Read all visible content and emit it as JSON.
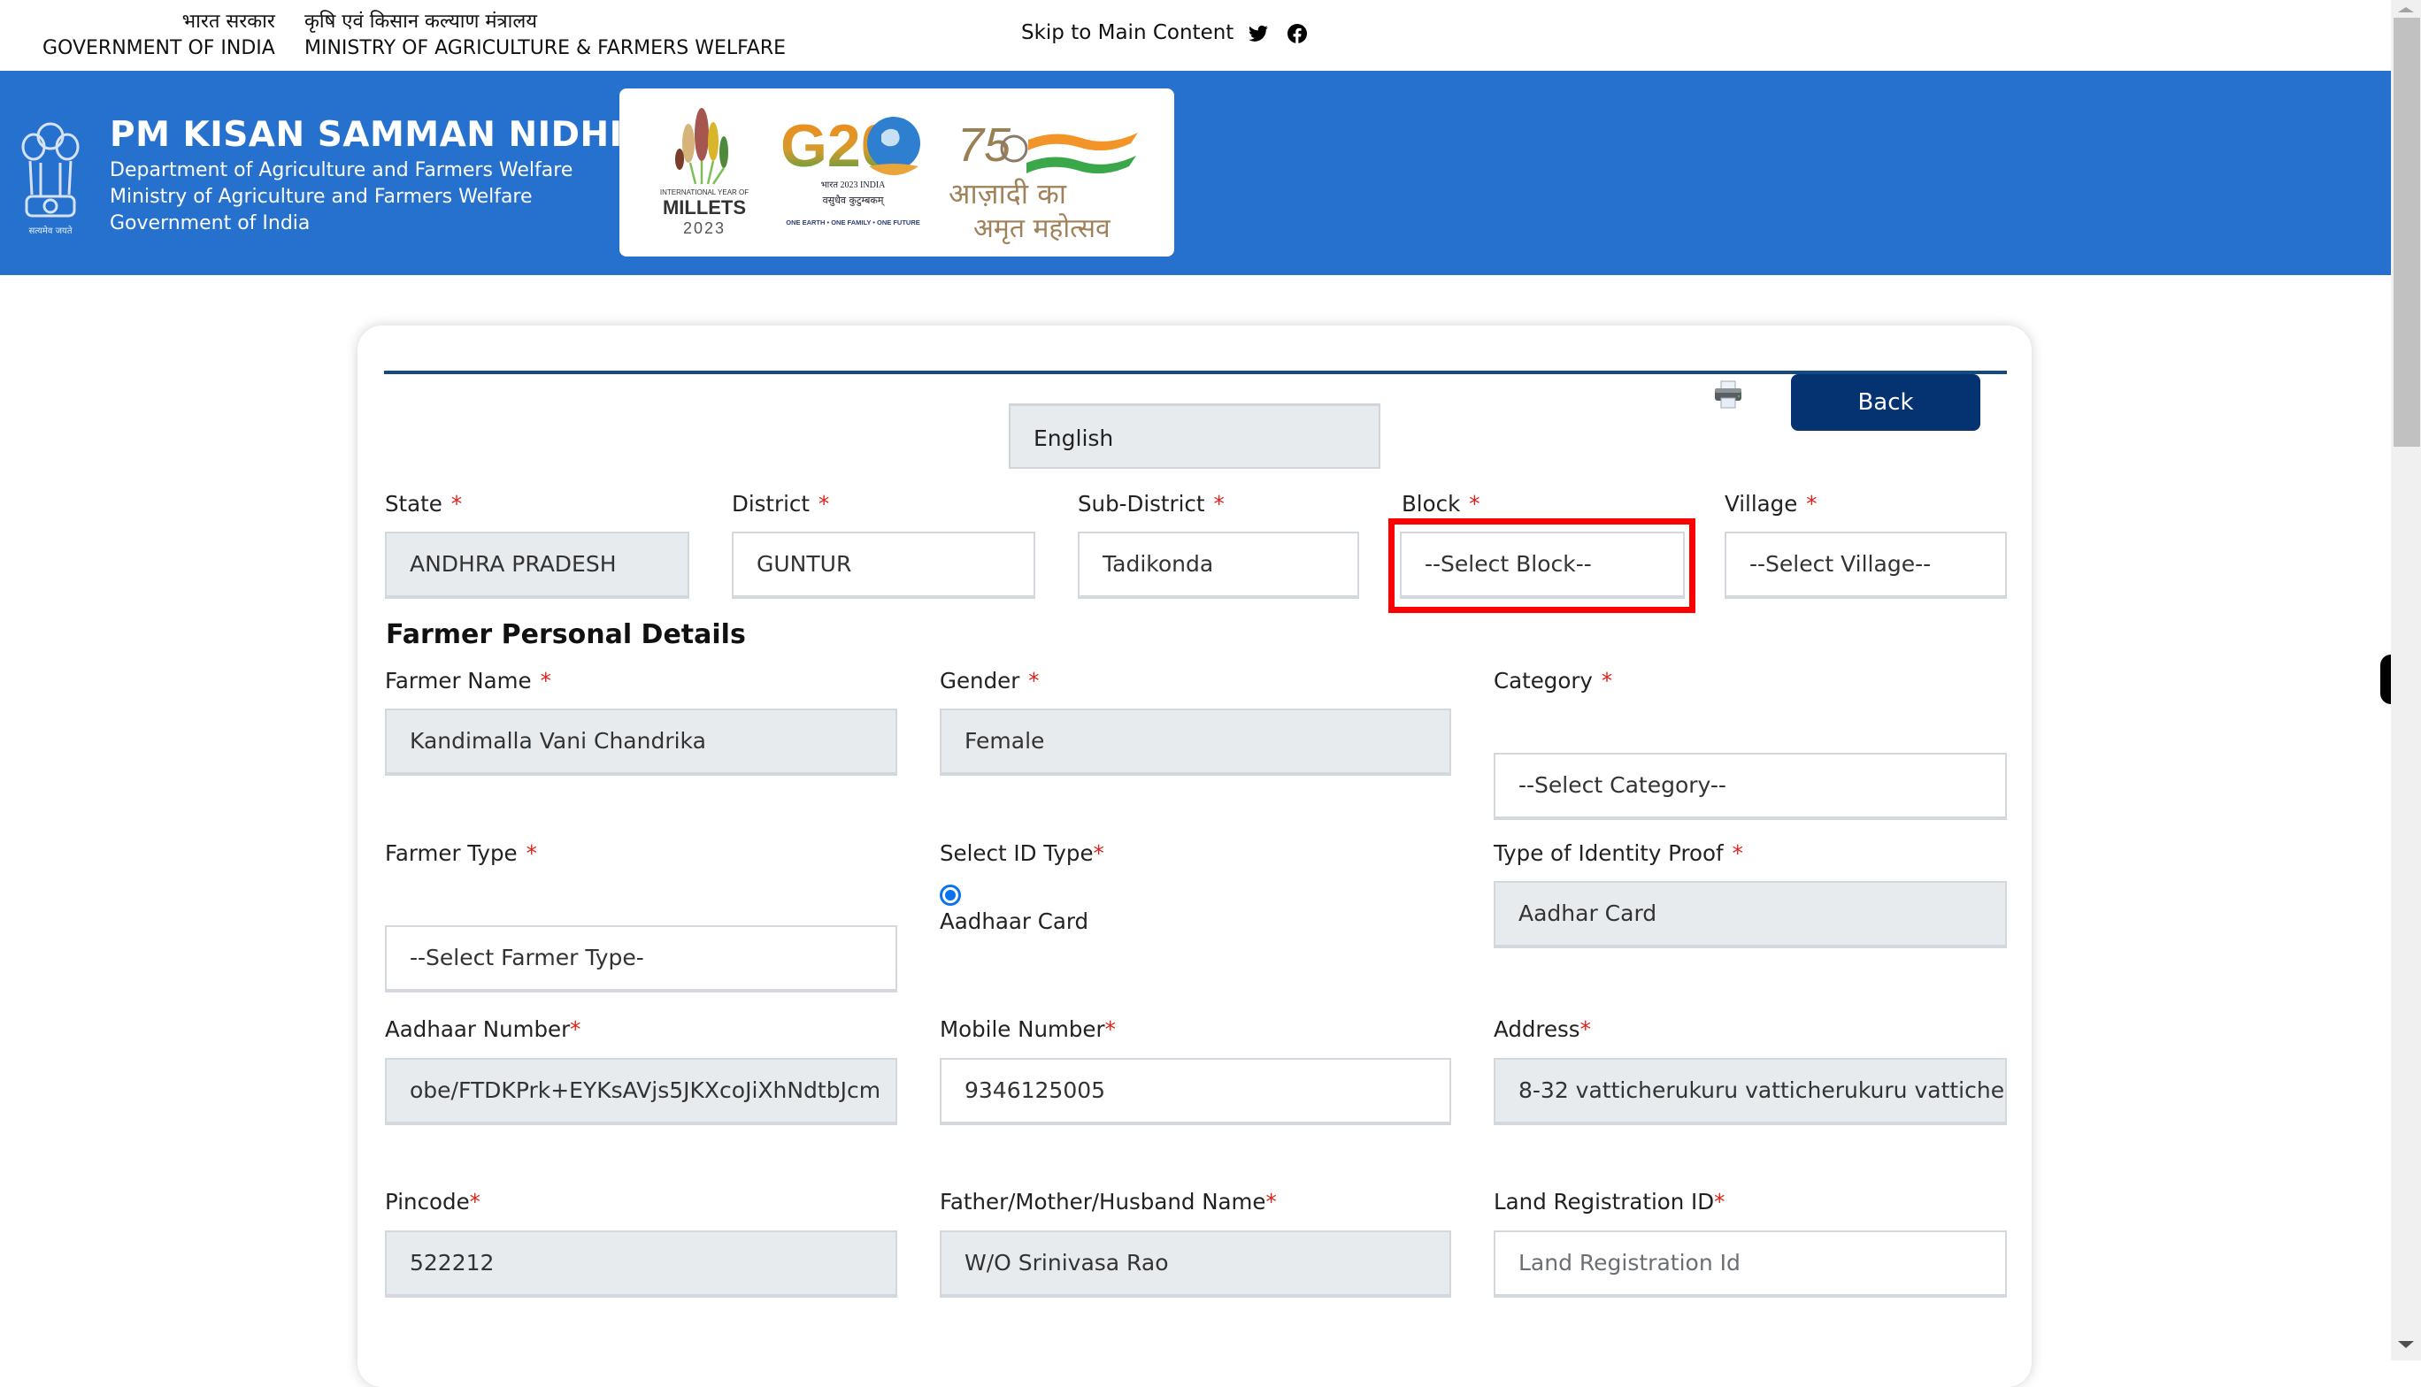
{
  "top_bar": {
    "gov_hindi": "भारत सरकार",
    "gov_english": "GOVERNMENT OF INDIA",
    "ministry_hindi": "कृषि एवं किसान कल्याण मंत्रालय",
    "ministry_english": "MINISTRY OF AGRICULTURE & FARMERS WELFARE",
    "skip_link": "Skip to Main Content",
    "social_icons": [
      "twitter-icon",
      "facebook-icon"
    ]
  },
  "header": {
    "title": "PM KISAN SAMMAN NIDHI",
    "lines": [
      "Department of Agriculture and Farmers Welfare",
      "Ministry of Agriculture and Farmers Welfare",
      "Government of India"
    ],
    "emblem_caption": "सत्यमेव जयते",
    "logos": {
      "millets": {
        "line1": "INTERNATIONAL YEAR OF",
        "line2": "MILLETS",
        "year": "2023"
      },
      "g20": {
        "text": "G20",
        "sub1": "भारत 2023 INDIA",
        "sub2": "वसुधैव कुटुम्बकम्",
        "tagline": "ONE EARTH • ONE FAMILY • ONE FUTURE"
      },
      "azadi": {
        "num": "75",
        "line1": "आज़ादी का",
        "line2": "अमृत महोत्सव"
      }
    }
  },
  "toolbar": {
    "back_label": "Back",
    "language": "English"
  },
  "location": {
    "state": {
      "label": "State",
      "value": "ANDHRA PRADESH"
    },
    "district": {
      "label": "District",
      "value": "GUNTUR"
    },
    "sub_district": {
      "label": "Sub-District",
      "value": "Tadikonda"
    },
    "block": {
      "label": "Block",
      "value": "--Select Block--"
    },
    "village": {
      "label": "Village",
      "value": "--Select Village--"
    }
  },
  "personal": {
    "section_title": "Farmer Personal Details",
    "farmer_name": {
      "label": "Farmer Name",
      "value": "Kandimalla Vani Chandrika"
    },
    "gender": {
      "label": "Gender",
      "value": "Female"
    },
    "category": {
      "label": "Category",
      "value": "--Select Category--"
    },
    "farmer_type": {
      "label": "Farmer Type",
      "value": "--Select Farmer Type-"
    },
    "id_type": {
      "label": "Select ID Type",
      "option": "Aadhaar Card",
      "selected": true
    },
    "identity_proof": {
      "label": "Type of Identity Proof",
      "value": "Aadhar Card"
    },
    "aadhaar_number": {
      "label": "Aadhaar Number",
      "value": "obe/FTDKPrk+EYKsAVjs5JKXcoJiXhNdtbJcm"
    },
    "mobile_number": {
      "label": "Mobile Number",
      "value": "9346125005"
    },
    "address": {
      "label": "Address",
      "value": "8-32 vatticherukuru vatticherukuru vattiche"
    },
    "pincode": {
      "label": "Pincode",
      "value": "522212"
    },
    "relative_name": {
      "label": "Father/Mother/Husband Name",
      "value": "W/O Srinivasa Rao"
    },
    "land_registration": {
      "label": "Land Registration ID",
      "value": "",
      "placeholder": "Land Registration Id"
    }
  },
  "required_marker": "*",
  "colors": {
    "header_blue": "#2671cd",
    "button_navy": "#053270",
    "required_red": "#e0201b",
    "highlight_red": "#ff0000"
  }
}
